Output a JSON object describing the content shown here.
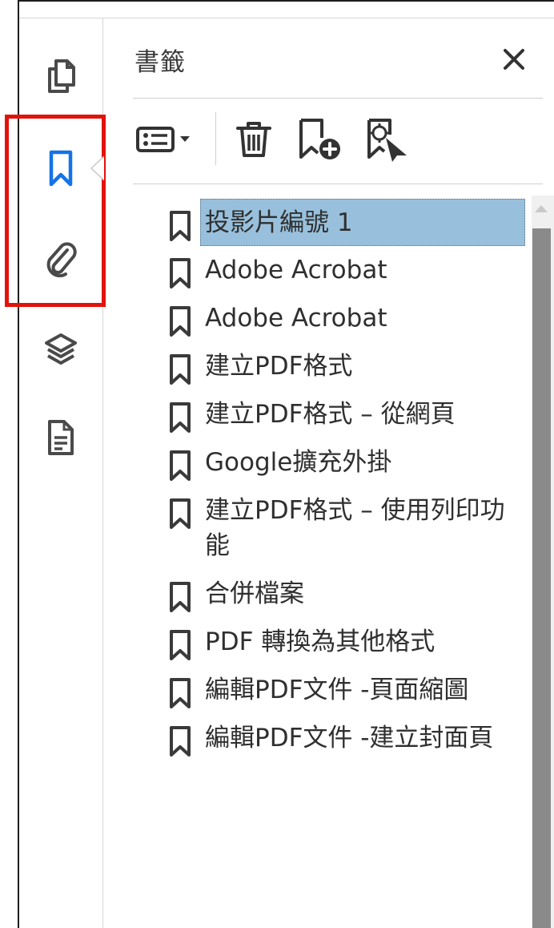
{
  "rail": {
    "icons": [
      "pages-icon",
      "bookmark-icon",
      "attachment-icon",
      "layers-icon",
      "document-properties-icon"
    ],
    "active": "bookmark-icon",
    "active_color": "#1473e6",
    "highlight_color": "#e3120b"
  },
  "panel": {
    "title": "書籤",
    "close_icon": "close-icon",
    "toolbar_icons": [
      "options-menu-icon",
      "delete-bookmark-icon",
      "new-bookmark-icon",
      "find-current-bookmark-icon"
    ]
  },
  "bookmarks": [
    {
      "label": "投影片編號 1",
      "selected": true
    },
    {
      "label": "Adobe Acrobat"
    },
    {
      "label": "Adobe Acrobat"
    },
    {
      "label": "建立PDF格式"
    },
    {
      "label": "建立PDF格式 – 從網頁"
    },
    {
      "label": "Google擴充外掛"
    },
    {
      "label": "建立PDF格式 – 使用列印功能"
    },
    {
      "label": "合併檔案"
    },
    {
      "label": "PDF 轉換為其他格式"
    },
    {
      "label": "編輯PDF文件 -頁面縮圖"
    },
    {
      "label": "編輯PDF文件 -建立封面頁"
    }
  ],
  "colors": {
    "selected_bg": "#98c0dc",
    "scroll_thumb": "#8a8a8a"
  }
}
